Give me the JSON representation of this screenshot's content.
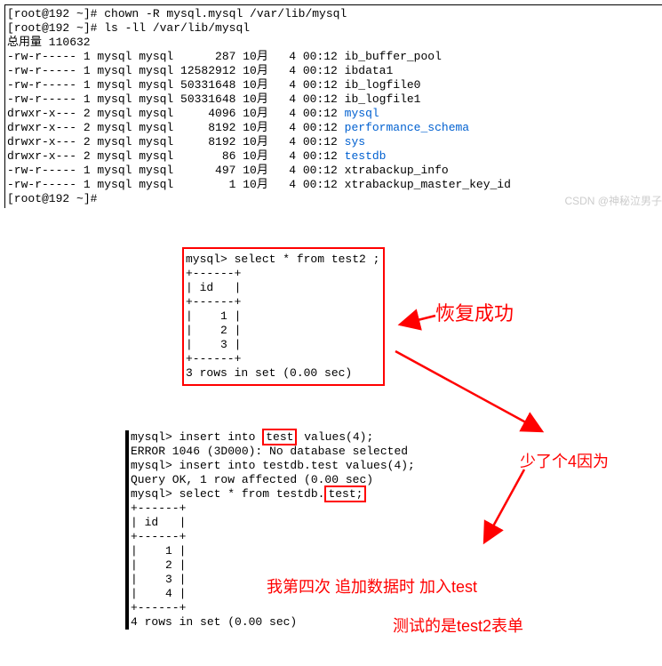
{
  "terminal": {
    "cmd1": "[root@192 ~]# chown -R mysql.mysql /var/lib/mysql",
    "cmd2": "[root@192 ~]# ls -ll /var/lib/mysql",
    "totalLine": "总用量 110632",
    "files": [
      {
        "perms": "-rw-r-----",
        "links": "1",
        "owner": "mysql",
        "group": "mysql",
        "size": "     287",
        "month": "10月",
        "day": "  4",
        "time": "00:12",
        "name": "ib_buffer_pool",
        "dir": false
      },
      {
        "perms": "-rw-r-----",
        "links": "1",
        "owner": "mysql",
        "group": "mysql",
        "size": "12582912",
        "month": "10月",
        "day": "  4",
        "time": "00:12",
        "name": "ibdata1",
        "dir": false
      },
      {
        "perms": "-rw-r-----",
        "links": "1",
        "owner": "mysql",
        "group": "mysql",
        "size": "50331648",
        "month": "10月",
        "day": "  4",
        "time": "00:12",
        "name": "ib_logfile0",
        "dir": false
      },
      {
        "perms": "-rw-r-----",
        "links": "1",
        "owner": "mysql",
        "group": "mysql",
        "size": "50331648",
        "month": "10月",
        "day": "  4",
        "time": "00:12",
        "name": "ib_logfile1",
        "dir": false
      },
      {
        "perms": "drwxr-x---",
        "links": "2",
        "owner": "mysql",
        "group": "mysql",
        "size": "    4096",
        "month": "10月",
        "day": "  4",
        "time": "00:12",
        "name": "mysql",
        "dir": true
      },
      {
        "perms": "drwxr-x---",
        "links": "2",
        "owner": "mysql",
        "group": "mysql",
        "size": "    8192",
        "month": "10月",
        "day": "  4",
        "time": "00:12",
        "name": "performance_schema",
        "dir": true
      },
      {
        "perms": "drwxr-x---",
        "links": "2",
        "owner": "mysql",
        "group": "mysql",
        "size": "    8192",
        "month": "10月",
        "day": "  4",
        "time": "00:12",
        "name": "sys",
        "dir": true
      },
      {
        "perms": "drwxr-x---",
        "links": "2",
        "owner": "mysql",
        "group": "mysql",
        "size": "      86",
        "month": "10月",
        "day": "  4",
        "time": "00:12",
        "name": "testdb",
        "dir": true
      },
      {
        "perms": "-rw-r-----",
        "links": "1",
        "owner": "mysql",
        "group": "mysql",
        "size": "     497",
        "month": "10月",
        "day": "  4",
        "time": "00:12",
        "name": "xtrabackup_info",
        "dir": false
      },
      {
        "perms": "-rw-r-----",
        "links": "1",
        "owner": "mysql",
        "group": "mysql",
        "size": "       1",
        "month": "10月",
        "day": "  4",
        "time": "00:12",
        "name": "xtrabackup_master_key_id",
        "dir": false
      }
    ],
    "cmd3": "[root@192 ~]# "
  },
  "box1": {
    "l1": "mysql> select * from test2 ;",
    "sep": "+------+",
    "hdr": "| id   |",
    "r1": "|    1 |",
    "r2": "|    2 |",
    "r3": "|    3 |",
    "ftr": "3 rows in set (0.00 sec)"
  },
  "box2": {
    "l1a": "mysql> insert into ",
    "l1b": "test",
    "l1c": " values(4);",
    "err": "ERROR 1046 (3D000): No database selected",
    "l2": "mysql> insert into testdb.test values(4);",
    "ok": "Query OK, 1 row affected (0.00 sec)",
    "blank": "",
    "l3a": "mysql> select * from testdb.",
    "l3b": "test;",
    "sep": "+------+",
    "hdr": "| id   |",
    "r1": "|    1 |",
    "r2": "|    2 |",
    "r3": "|    3 |",
    "r4": "|    4 |",
    "ftr": "4 rows in set (0.00 sec)"
  },
  "annotations": {
    "a1": "恢复成功",
    "a2": "少了个4因为",
    "a3": "我第四次 追加数据时 加入test",
    "a4": "测试的是test2表单"
  },
  "watermark": "CSDN @神秘泣男子"
}
